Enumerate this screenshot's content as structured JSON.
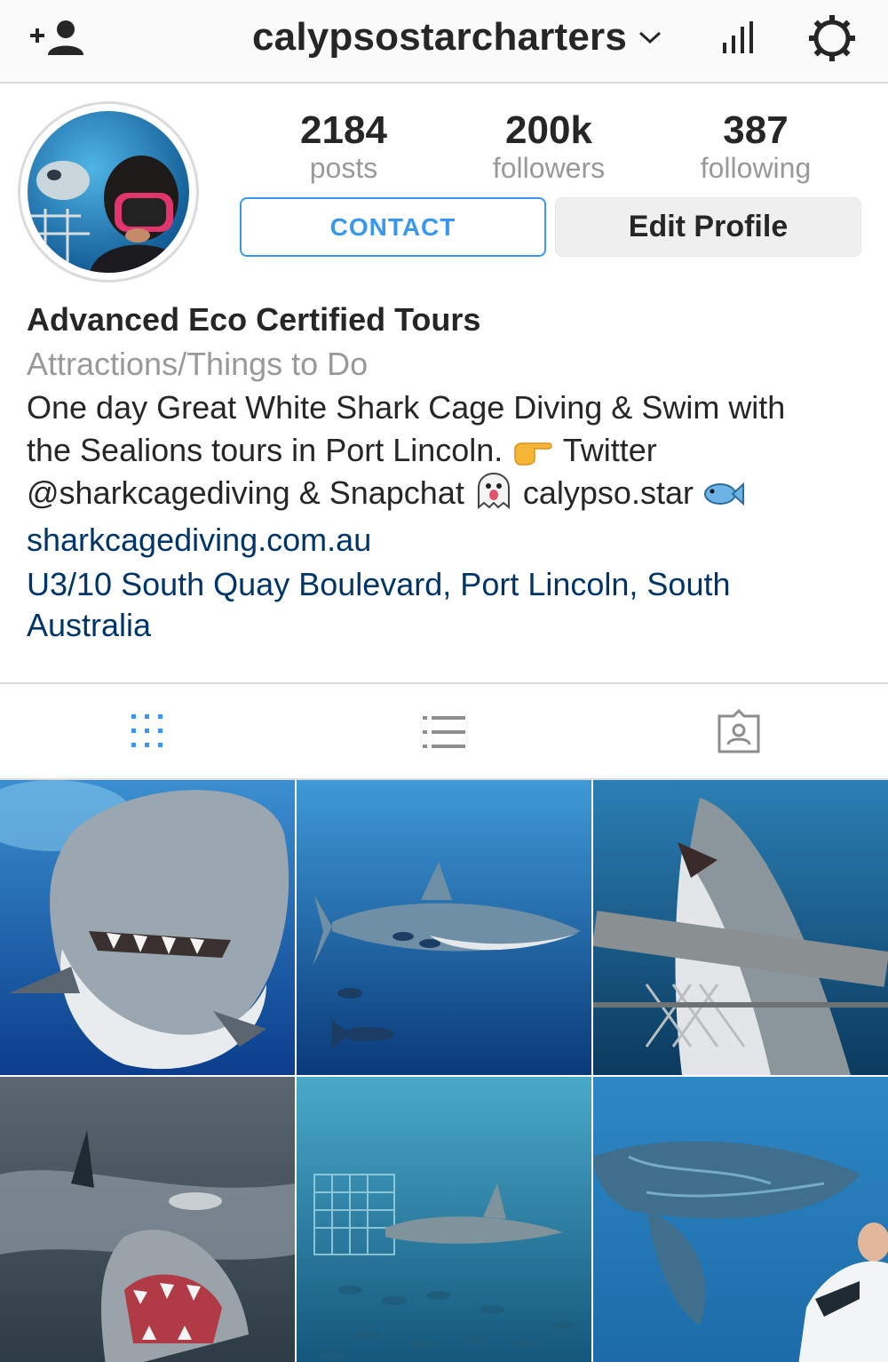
{
  "header": {
    "username": "calypsostarcharters",
    "icons": {
      "left": "add-user-icon",
      "switch": "chevron-down-icon",
      "insights": "insights-icon",
      "settings": "gear-icon"
    }
  },
  "profile": {
    "stats": {
      "posts_count": "2184",
      "posts_label": "posts",
      "followers_count": "200k",
      "followers_label": "followers",
      "following_count": "387",
      "following_label": "following"
    },
    "contact_label": "CONTACT",
    "edit_label": "Edit Profile"
  },
  "bio": {
    "name": "Advanced Eco Certified Tours",
    "category": "Attractions/Things to Do",
    "line1": "One day Great White Shark Cage Diving & Swim with",
    "line2a": "the Sealions tours in Port Lincoln.",
    "line2b": "Twitter",
    "line3a": "@sharkcagediving & Snapchat",
    "line3b": "calypso.star",
    "link": "sharkcagediving.com.au",
    "address_line1": "U3/10 South Quay Boulevard, Port Lincoln, South",
    "address_line2": "Australia"
  },
  "tabs": [
    {
      "icon": "grid-icon",
      "active": true
    },
    {
      "icon": "list-icon",
      "active": false
    },
    {
      "icon": "tagged-icon",
      "active": false
    }
  ],
  "colors": {
    "accent_blue": "#3897f0",
    "link_blue": "#003569",
    "text": "#262626",
    "muted": "#999999",
    "divider": "#dbdbdb"
  },
  "posts_count_visible": 6
}
